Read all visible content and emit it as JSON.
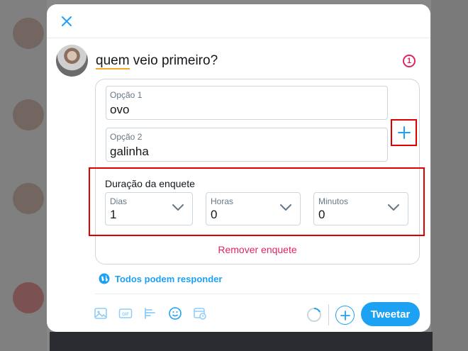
{
  "colors": {
    "accent": "#1da1f2",
    "danger": "#e0245e",
    "highlight_box": "#e00000"
  },
  "compose": {
    "text_underlined": "quem",
    "text_rest": " veio primeiro?",
    "char_counter": "1"
  },
  "poll": {
    "options": [
      {
        "label": "Opção 1",
        "value": "ovo"
      },
      {
        "label": "Opção 2",
        "value": "galinha"
      }
    ],
    "add_option_icon": "plus-icon",
    "duration": {
      "title": "Duração da enquete",
      "days": {
        "label": "Dias",
        "value": "1"
      },
      "hours": {
        "label": "Horas",
        "value": "0"
      },
      "minutes": {
        "label": "Minutos",
        "value": "0"
      }
    },
    "remove_label": "Remover enquete"
  },
  "reply_setting": {
    "label": "Todos podem responder",
    "icon": "globe-icon"
  },
  "toolbar": {
    "icons": [
      "image-icon",
      "gif-icon",
      "poll-icon",
      "emoji-icon",
      "schedule-icon"
    ],
    "tweet_label": "Tweetar"
  }
}
